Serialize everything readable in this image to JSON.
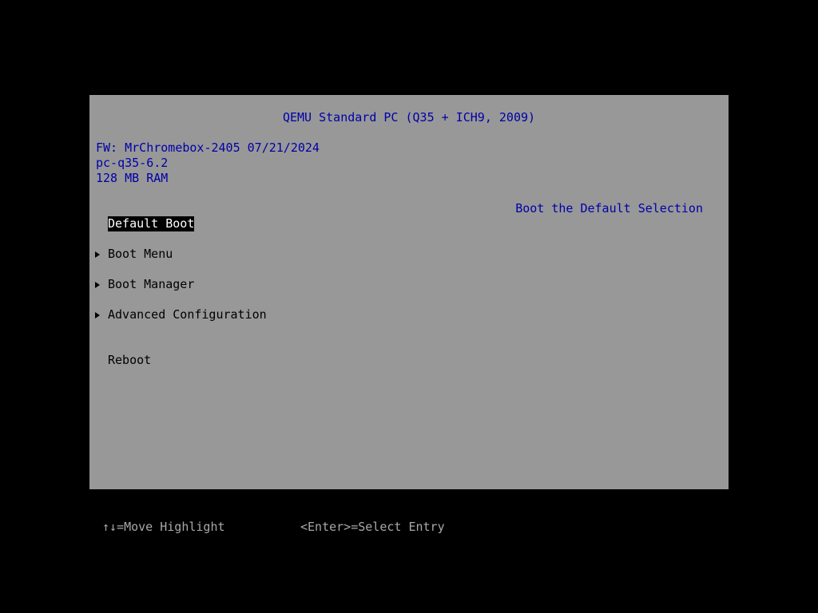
{
  "header": {
    "title": "QEMU Standard PC (Q35 + ICH9, 2009)"
  },
  "system_info": {
    "firmware": "FW: MrChromebox-2405 07/21/2024",
    "model": "pc-q35-6.2",
    "memory": "128 MB RAM"
  },
  "help_text": "Boot the Default Selection",
  "menu": {
    "items": [
      {
        "label": "Default Boot",
        "selected": true,
        "submenu": false
      },
      {
        "label": "Boot Menu",
        "selected": false,
        "submenu": true
      },
      {
        "label": "Boot Manager",
        "selected": false,
        "submenu": true
      },
      {
        "label": "Advanced Configuration",
        "selected": false,
        "submenu": true
      },
      {
        "label": "Reboot",
        "selected": false,
        "submenu": false
      }
    ]
  },
  "footer": {
    "move_hint": "↑↓=Move Highlight",
    "select_hint": "<Enter>=Select Entry"
  },
  "colors": {
    "background": "#000000",
    "panel": "#989898",
    "info_text": "#0000a8",
    "highlight_bg": "#000000",
    "highlight_text": "#ffffff",
    "footer_text": "#a8a8a8"
  }
}
